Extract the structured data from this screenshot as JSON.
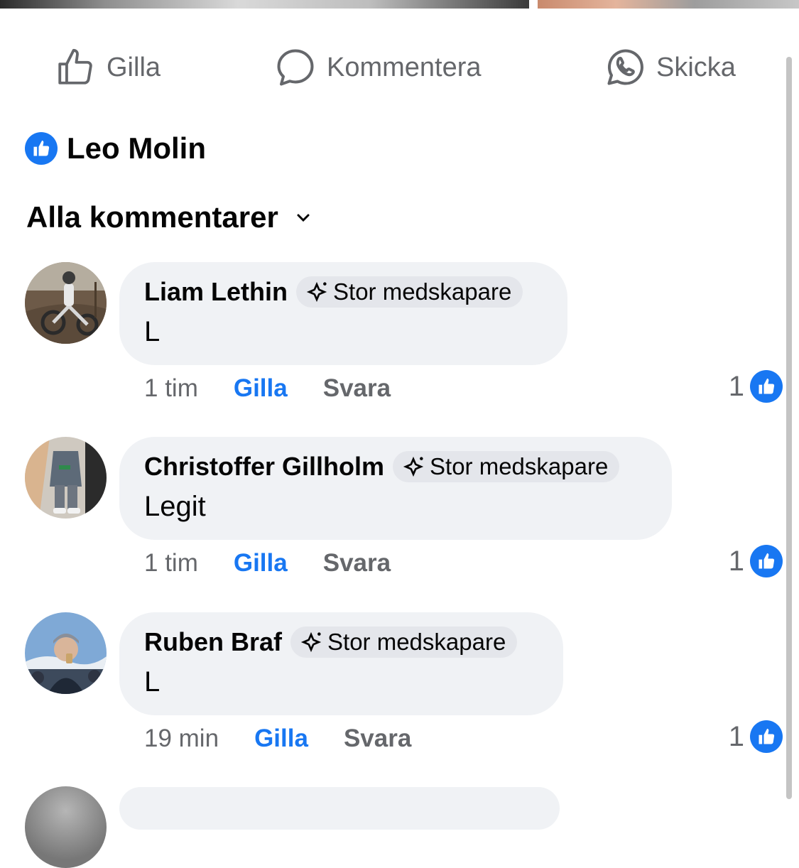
{
  "actions": {
    "like": "Gilla",
    "comment": "Kommentera",
    "send": "Skicka"
  },
  "reactions": {
    "name": "Leo Molin",
    "icon": "like-icon"
  },
  "filter": {
    "label": "Alla kommentarer",
    "icon": "chevron-down-icon"
  },
  "comments": [
    {
      "author": "Liam Lethin",
      "badge": "Stor medskapare",
      "text": "L",
      "time": "1 tim",
      "like": "Gilla",
      "reply": "Svara",
      "likes": "1"
    },
    {
      "author": "Christoffer Gillholm",
      "badge": "Stor medskapare",
      "text": "Legit",
      "time": "1 tim",
      "like": "Gilla",
      "reply": "Svara",
      "likes": "1"
    },
    {
      "author": "Ruben Braf",
      "badge": "Stor medskapare",
      "text": "L",
      "time": "19 min",
      "like": "Gilla",
      "reply": "Svara",
      "likes": "1"
    }
  ],
  "colors": {
    "accent": "#1877f2",
    "bubble": "#f0f2f5",
    "secondary_text": "#65676b"
  }
}
